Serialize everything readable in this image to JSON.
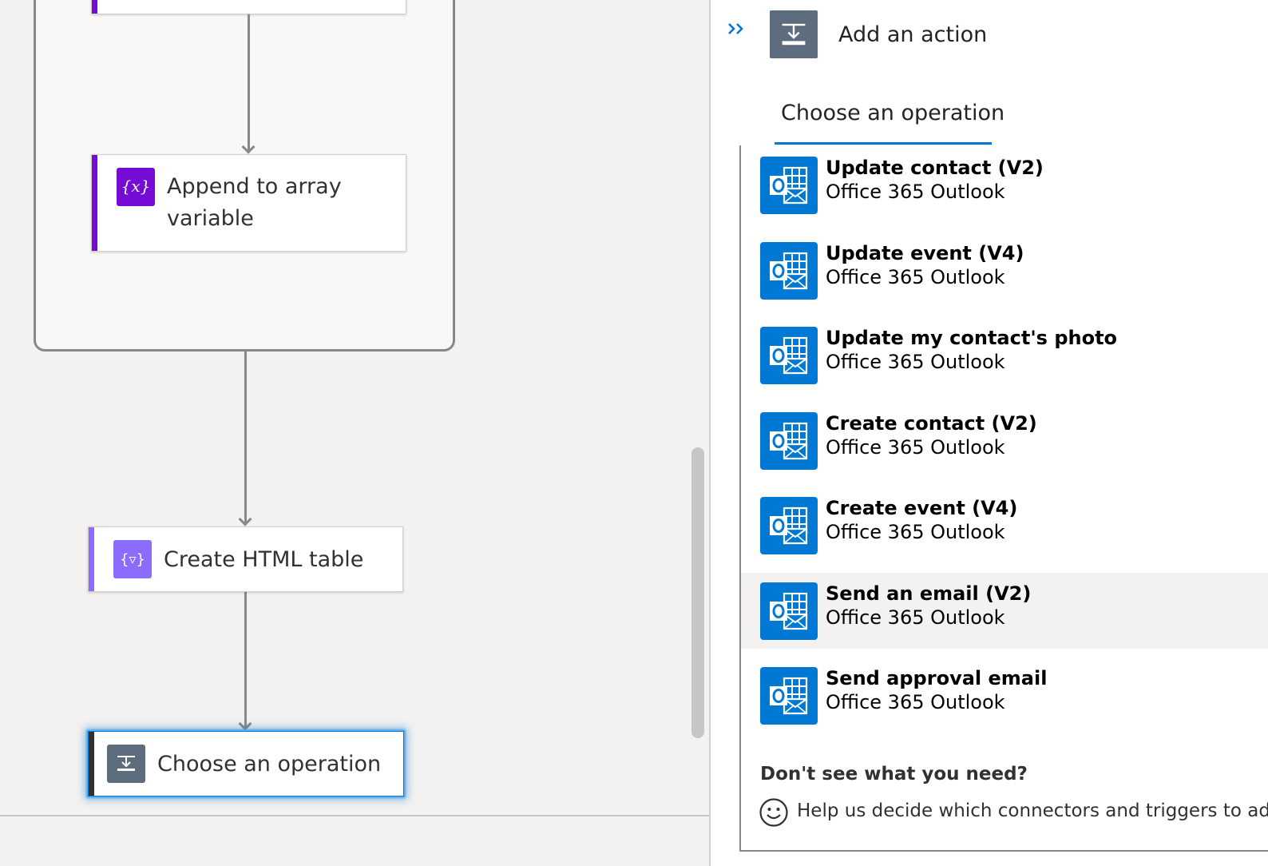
{
  "canvas": {
    "cards": {
      "append": {
        "title_line1": "Append to array",
        "title_line2": "variable",
        "icon": "variable-icon",
        "accent": "#770bd6"
      },
      "html_table": {
        "title": "Create HTML table",
        "icon": "data-operation-icon",
        "accent": "#8c6cff"
      },
      "choose": {
        "title": "Choose an operation",
        "icon": "operation-icon",
        "accent": "#323130"
      }
    }
  },
  "panel": {
    "title": "Add an action",
    "tab": "Choose an operation",
    "operations": [
      {
        "name": "Update contact (V2)",
        "connector": "Office 365 Outlook"
      },
      {
        "name": "Update event (V4)",
        "connector": "Office 365 Outlook"
      },
      {
        "name": "Update my contact's photo",
        "connector": "Office 365 Outlook"
      },
      {
        "name": "Create contact (V2)",
        "connector": "Office 365 Outlook"
      },
      {
        "name": "Create event (V4)",
        "connector": "Office 365 Outlook"
      },
      {
        "name": "Send an email (V2)",
        "connector": "Office 365 Outlook"
      },
      {
        "name": "Send approval email",
        "connector": "Office 365 Outlook"
      }
    ],
    "hovered_index": 5,
    "dont_see": "Don't see what you need?",
    "help": "Help us decide which connectors and triggers to add n"
  },
  "colors": {
    "outlook_blue": "#0078d4",
    "variable_purple": "#770bd6",
    "data_op_purple": "#8c6cff",
    "header_icon_gray": "#5e6d7e"
  }
}
